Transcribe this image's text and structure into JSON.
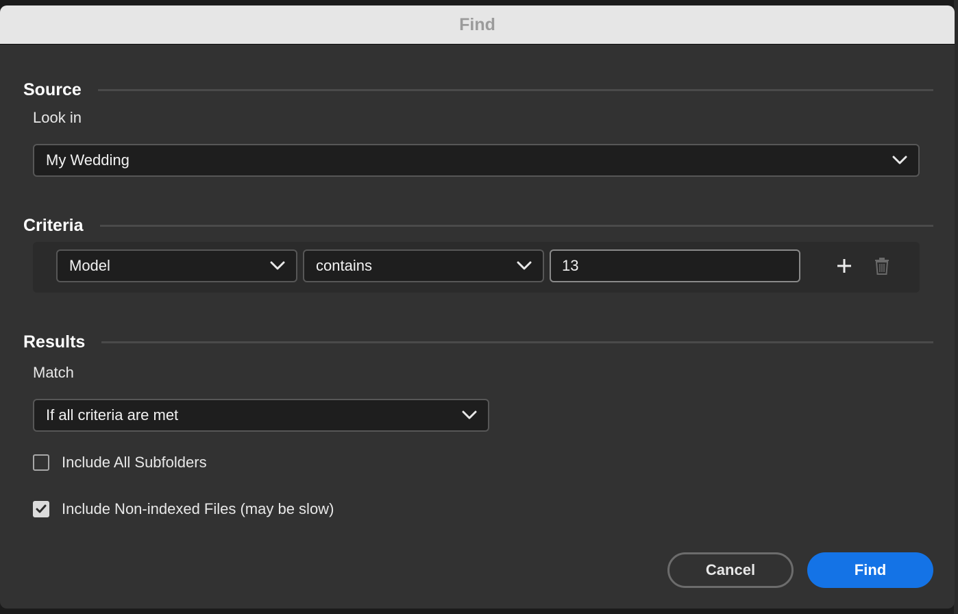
{
  "dialog": {
    "title": "Find"
  },
  "source": {
    "heading": "Source",
    "look_in_label": "Look in",
    "look_in_value": "My Wedding"
  },
  "criteria": {
    "heading": "Criteria",
    "rows": [
      {
        "field": "Model",
        "operator": "contains",
        "value": "13"
      }
    ],
    "icons": {
      "add": "plus-icon",
      "delete": "trash-icon"
    }
  },
  "results": {
    "heading": "Results",
    "match_label": "Match",
    "match_value": "If all criteria are met",
    "include_subfolders": {
      "label": "Include All Subfolders",
      "checked": false
    },
    "include_non_indexed": {
      "label": "Include Non-indexed Files (may be slow)",
      "checked": true
    }
  },
  "buttons": {
    "cancel": "Cancel",
    "find": "Find"
  },
  "colors": {
    "accent": "#1473e6",
    "dialog_bg": "#323232",
    "title_bar": "#e6e6e6"
  }
}
